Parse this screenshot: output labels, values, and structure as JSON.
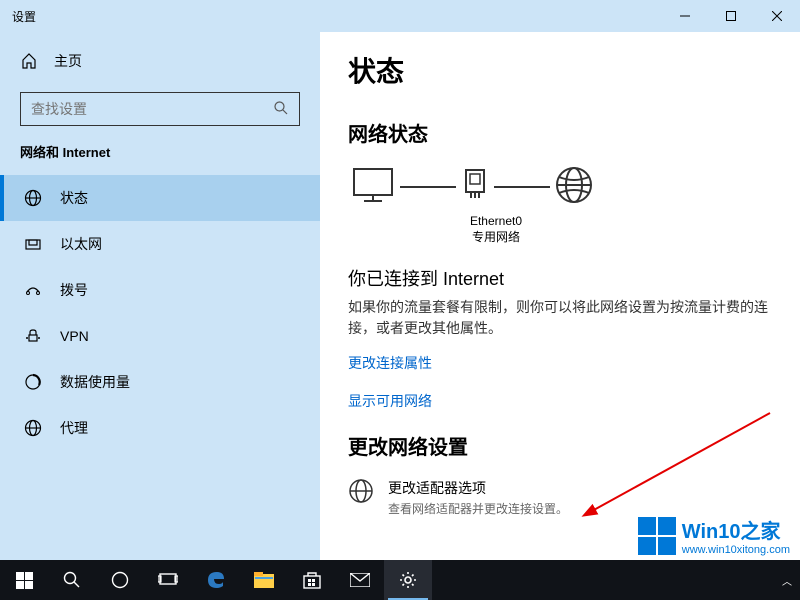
{
  "window": {
    "title": "设置"
  },
  "sidebar": {
    "home": "主页",
    "searchPlaceholder": "查找设置",
    "sectionTitle": "网络和 Internet",
    "items": [
      {
        "label": "状态",
        "active": true
      },
      {
        "label": "以太网",
        "active": false
      },
      {
        "label": "拨号",
        "active": false
      },
      {
        "label": "VPN",
        "active": false
      },
      {
        "label": "数据使用量",
        "active": false
      },
      {
        "label": "代理",
        "active": false
      }
    ]
  },
  "main": {
    "pageTitle": "状态",
    "networkStatusTitle": "网络状态",
    "adapterName": "Ethernet0",
    "networkType": "专用网络",
    "connectedTitle": "你已连接到 Internet",
    "connectedDesc": "如果你的流量套餐有限制，则你可以将此网络设置为按流量计费的连接，或者更改其他属性。",
    "changeProps": "更改连接属性",
    "showNetworks": "显示可用网络",
    "changeSettingsTitle": "更改网络设置",
    "adapterOptTitle": "更改适配器选项",
    "adapterOptDesc": "查看网络适配器并更改连接设置。"
  },
  "watermark": {
    "brand": "Win10之家",
    "url": "www.win10xitong.com"
  }
}
